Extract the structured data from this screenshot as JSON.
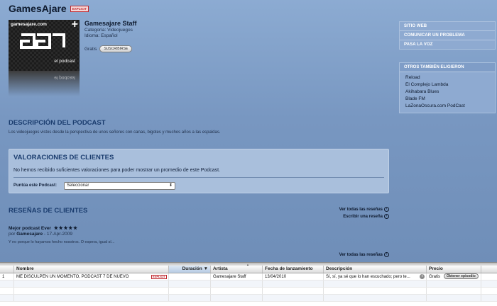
{
  "header": {
    "title": "GamesAjare",
    "explicit_badge": "EXPLICIT"
  },
  "artwork": {
    "site": "gamesajare.com",
    "subtitle": "el podcast",
    "plus": "+"
  },
  "podcast": {
    "artist": "Gamesajare Staff",
    "category": "Categoría: Videojuegos",
    "language": "Idioma: Español",
    "price": "Gratis",
    "subscribe_label": "SUSCRIBIRSE"
  },
  "right_links": [
    "SITIO WEB",
    "COMUNICAR UN PROBLEMA",
    "PASA LA VOZ"
  ],
  "also_chose": {
    "title": "OTROS TAMBIÉN ELIGIERON",
    "items": [
      "Reload",
      "El Complejo Lambda",
      "Akihabara Blues",
      "Blade FM",
      "LaZonaOscura.com PodCast"
    ]
  },
  "description": {
    "title": "DESCRIPCIÓN DEL PODCAST",
    "text": "Los videojuegos vistos desde la perspectiva de unos señores con canas, bigotes y muchos años a las espaldas."
  },
  "ratings": {
    "title": "VALORACIONES DE CLIENTES",
    "message": "No hemos recibido suficientes valoraciones para poder mostrar un promedio de este Podcast.",
    "rate_label": "Puntúa este Podcast:",
    "select_value": "Seleccionar",
    "rating_value": 0
  },
  "reviews": {
    "title": "RESEÑAS DE CLIENTES",
    "see_all": "Ver todas las reseñas",
    "write": "Escribir una reseña",
    "see_all_bottom": "Ver todas las reseñas",
    "items": [
      {
        "title": "Mejor podcast Ever",
        "stars": "★★★★★",
        "rating": 5,
        "by_prefix": "por",
        "author": "Gamesajare",
        "date": "- 17-Apr-2009",
        "body": "Y no porque lo hayamos hecho nosotros. O espera, igual sí..."
      }
    ]
  },
  "table": {
    "columns": [
      "",
      "Nombre",
      "Duración",
      "Artista",
      "Fecha de lanzamiento",
      "Descripción",
      "Precio"
    ],
    "sort_indicator": "▼",
    "rows": [
      {
        "num": "1",
        "name": "ME DISCULPEN UN MOMENTO, PODCAST 7 DE NUEVO",
        "explicit": "EXPLICIT",
        "duration": "",
        "artist": "Gamesajare Staff",
        "date": "13/04/2010",
        "description": "Sí, sí, ya sé que lo han escuchado; pero te...",
        "price": "Gratis",
        "get_label": "Obtener episodio"
      }
    ]
  },
  "colors": {
    "background": "#7d9cc4",
    "accent_title": "#1a3c6e",
    "explicit": "#c0272d"
  },
  "icons": [
    "info-icon",
    "arrow-right-circle-icon",
    "dropdown-arrow-icon",
    "sort-down-icon"
  ]
}
